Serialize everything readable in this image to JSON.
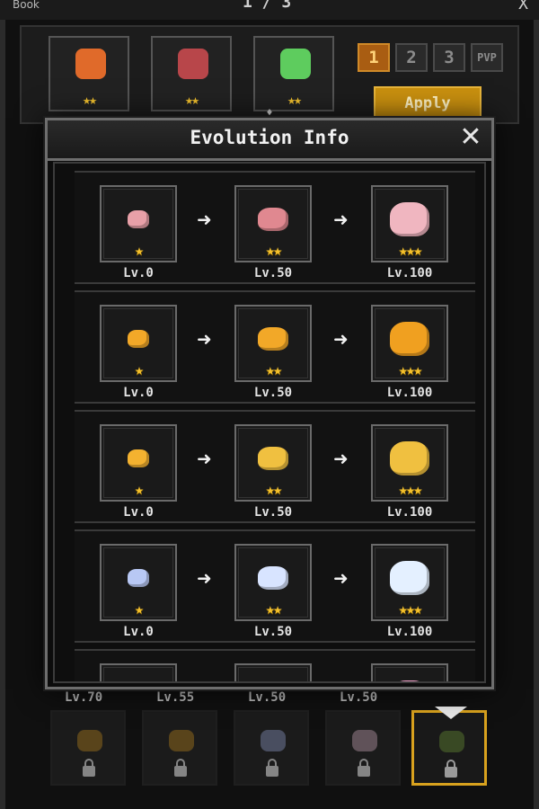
{
  "background": {
    "book_tab": "Book",
    "title": "1 / 3",
    "close": "X",
    "active_slots": [
      {
        "pet": "fox-pet-icon",
        "stars": "★★",
        "color": "#e06a2a"
      },
      {
        "pet": "bird-pet-icon",
        "stars": "★★",
        "color": "#b8464a"
      },
      {
        "pet": "fairy-pet-icon",
        "stars": "★★",
        "color": "#5ecc5e"
      }
    ],
    "page_buttons": [
      "1",
      "2",
      "3",
      "PVP"
    ],
    "apply_label": "Apply",
    "bottom_levels": [
      "Lv.70",
      "Lv.55",
      "Lv.50",
      "Lv.50"
    ]
  },
  "modal": {
    "title": "Evolution Info",
    "close_label": "✕",
    "arrow": "➜",
    "rows": [
      {
        "stages": [
          {
            "level": "Lv.0",
            "stars": "★",
            "pet": "pink-cat-pet-icon",
            "color": "#e8a0a8"
          },
          {
            "level": "Lv.50",
            "stars": "★★",
            "pet": "pink-cat-pet-icon",
            "color": "#e08890"
          },
          {
            "level": "Lv.100",
            "stars": "★★★",
            "pet": "winged-cat-pet-icon",
            "color": "#f0b6c0"
          }
        ]
      },
      {
        "stages": [
          {
            "level": "Lv.0",
            "stars": "★",
            "pet": "piglet-pet-icon",
            "color": "#f2a828"
          },
          {
            "level": "Lv.50",
            "stars": "★★",
            "pet": "piglet-bow-pet-icon",
            "color": "#f2a828"
          },
          {
            "level": "Lv.100",
            "stars": "★★★",
            "pet": "king-pig-pet-icon",
            "color": "#f0a020"
          }
        ]
      },
      {
        "stages": [
          {
            "level": "Lv.0",
            "stars": "★",
            "pet": "chick-pet-icon",
            "color": "#f4b230"
          },
          {
            "level": "Lv.50",
            "stars": "★★",
            "pet": "helmet-chick-pet-icon",
            "color": "#f0c040"
          },
          {
            "level": "Lv.100",
            "stars": "★★★",
            "pet": "knight-chick-pet-icon",
            "color": "#f0c040"
          }
        ]
      },
      {
        "stages": [
          {
            "level": "Lv.0",
            "stars": "★",
            "pet": "ghost-pet-icon",
            "color": "#b8c8f4"
          },
          {
            "level": "Lv.50",
            "stars": "★★",
            "pet": "ghost-pet-icon",
            "color": "#d8e4ff"
          },
          {
            "level": "Lv.100",
            "stars": "★★★",
            "pet": "spirit-ghost-pet-icon",
            "color": "#e4f0ff"
          }
        ]
      },
      {
        "stages": [
          {
            "level": "",
            "stars": "",
            "pet": "unknown-pet-icon",
            "color": "#888888"
          },
          {
            "level": "",
            "stars": "",
            "pet": "pink-pet-icon",
            "color": "#e070b0"
          },
          {
            "level": "",
            "stars": "",
            "pet": "pink-winged-pet-icon",
            "color": "#f0a0c8"
          }
        ]
      }
    ]
  }
}
